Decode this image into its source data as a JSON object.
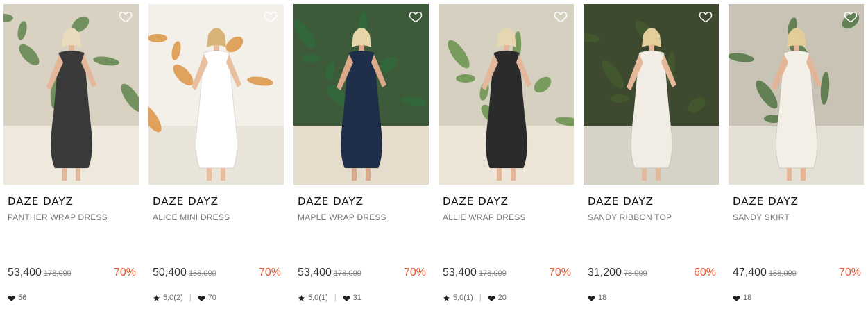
{
  "products": [
    {
      "brand": "DAZE DAYZ",
      "name": "PANTHER WRAP DRESS",
      "price": "53,400",
      "original_price": "178,000",
      "discount": "70%",
      "rating": "",
      "likes": "56",
      "palette": {
        "bg": "#d9d2c2",
        "ground": "#efe9dd",
        "plant": "#4f7a3c",
        "dress": "#3a3a3a",
        "skin": "#e3b79a",
        "hair": "#e9dcbc"
      }
    },
    {
      "brand": "DAZE DAYZ",
      "name": "ALICE MINI DRESS",
      "price": "50,400",
      "original_price": "168,000",
      "discount": "70%",
      "rating": "5,0(2)",
      "likes": "70",
      "palette": {
        "bg": "#f3f0ea",
        "ground": "#e9e4da",
        "plant": "#d98a2e",
        "dress": "#ffffff",
        "skin": "#e8c0a0",
        "hair": "#d8b478"
      }
    },
    {
      "brand": "DAZE DAYZ",
      "name": "MAPLE WRAP DRESS",
      "price": "53,400",
      "original_price": "178,000",
      "discount": "70%",
      "rating": "5,0(1)",
      "likes": "31",
      "palette": {
        "bg": "#3d5a3a",
        "ground": "#e6dccb",
        "plant": "#2f6b3c",
        "dress": "#1f2f4a",
        "skin": "#dba98a",
        "hair": "#e8d6a8"
      }
    },
    {
      "brand": "DAZE DAYZ",
      "name": "ALLIE WRAP DRESS",
      "price": "53,400",
      "original_price": "178,000",
      "discount": "70%",
      "rating": "5,0(1)",
      "likes": "20",
      "palette": {
        "bg": "#d6d0c0",
        "ground": "#ece5d7",
        "plant": "#5b8a3d",
        "dress": "#2b2b2b",
        "skin": "#e2b79a",
        "hair": "#e7d7b0"
      }
    },
    {
      "brand": "DAZE DAYZ",
      "name": "SANDY RIBBON TOP",
      "price": "31,200",
      "original_price": "78,000",
      "discount": "60%",
      "rating": "",
      "likes": "18",
      "palette": {
        "bg": "#3e4a30",
        "ground": "#d7d2c6",
        "plant": "#465c2e",
        "dress": "#f1ece4",
        "skin": "#e5b89a",
        "hair": "#e4cf9c"
      }
    },
    {
      "brand": "DAZE DAYZ",
      "name": "SANDY SKIRT",
      "price": "47,400",
      "original_price": "158,000",
      "discount": "70%",
      "rating": "",
      "likes": "18",
      "palette": {
        "bg": "#c9c3b6",
        "ground": "#e4dfd5",
        "plant": "#3f6a32",
        "dress": "#f3eee6",
        "skin": "#e3b596",
        "hair": "#e2cd9a"
      }
    }
  ],
  "icons": {
    "wishlist": "heart-outline-icon",
    "like": "heart-icon",
    "rating": "star-icon"
  },
  "colors": {
    "discount": "#e8542f",
    "brand": "#111111",
    "name": "#777777"
  }
}
